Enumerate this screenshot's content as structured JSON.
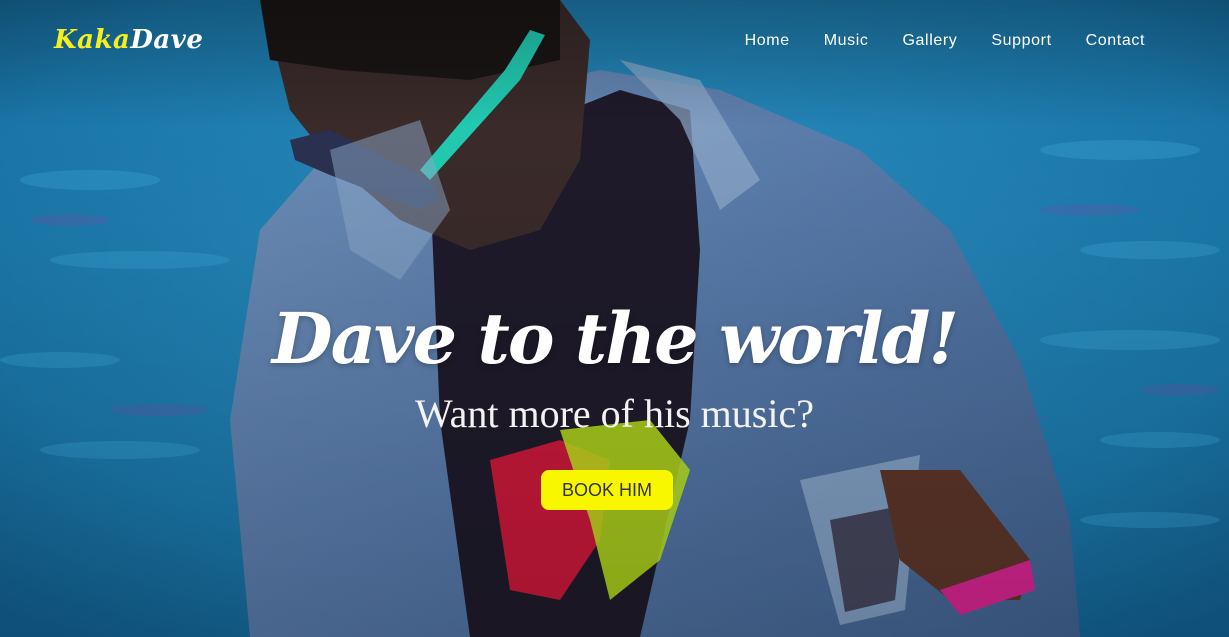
{
  "brand": {
    "logo_part1": "Kaka",
    "logo_part2": "Dave"
  },
  "nav": {
    "items": [
      {
        "label": "Home"
      },
      {
        "label": "Music"
      },
      {
        "label": "Gallery"
      },
      {
        "label": "Support"
      },
      {
        "label": "Contact"
      }
    ]
  },
  "hero": {
    "title": "Dave to the world!",
    "subtitle": "Want more of his music?",
    "cta_label": "BOOK HIM"
  },
  "colors": {
    "logo_accent": "#f5ef1e",
    "cta_background": "#f9f700",
    "background_blue": "#1c7fb0"
  }
}
